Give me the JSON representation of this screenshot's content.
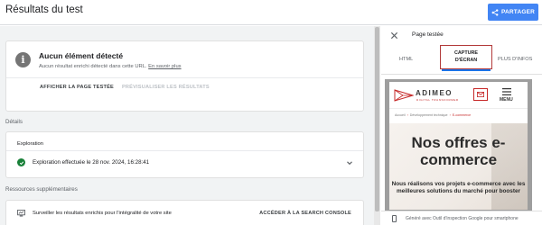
{
  "header": {
    "title": "Résultats du test",
    "share_label": "PARTAGER"
  },
  "summary_card": {
    "title": "Aucun élément détecté",
    "description": "Aucun résultat enrichi détecté dans cette URL.",
    "learn_more": "En savoir plus",
    "view_page_button": "AFFICHER LA PAGE TESTÉE",
    "preview_button": "PRÉVISUALISER LES RÉSULTATS"
  },
  "details": {
    "section_label": "Détails",
    "exploration_label": "Exploration",
    "exploration_status": "Exploration effectuée le 28 nov. 2024, 16:28:41"
  },
  "resources": {
    "section_label": "Ressources supplémentaires",
    "monitor_text": "Surveiller les résultats enrichis pour l'intégralité de votre site",
    "search_console_link": "ACCÉDER À LA SEARCH CONSOLE"
  },
  "panel": {
    "title": "Page testée",
    "tabs": [
      {
        "label": "HTML"
      },
      {
        "label_line1": "CAPTURE",
        "label_line2": "D'ÉCRAN"
      },
      {
        "label": "PLUS D'INFOS"
      }
    ],
    "footer_text": "Généré avec Outil d'inspection Google pour smartphone"
  },
  "screenshot": {
    "logo": "ADIMEO",
    "logo_sub": "DIGITAL TRANSFORMER",
    "menu_label": "MENU",
    "breadcrumb": [
      "Accueil",
      "Développement technique",
      "E-commerce"
    ],
    "hero_title": "Nos offres e-commerce",
    "hero_text": "Nous réalisons vos projets e-commerce avec les meilleures solutions du marché pour booster"
  },
  "colors": {
    "accent": "#4285f4",
    "tab_highlight": "#b23a3a",
    "success": "#188038",
    "brand_red": "#c62828"
  }
}
